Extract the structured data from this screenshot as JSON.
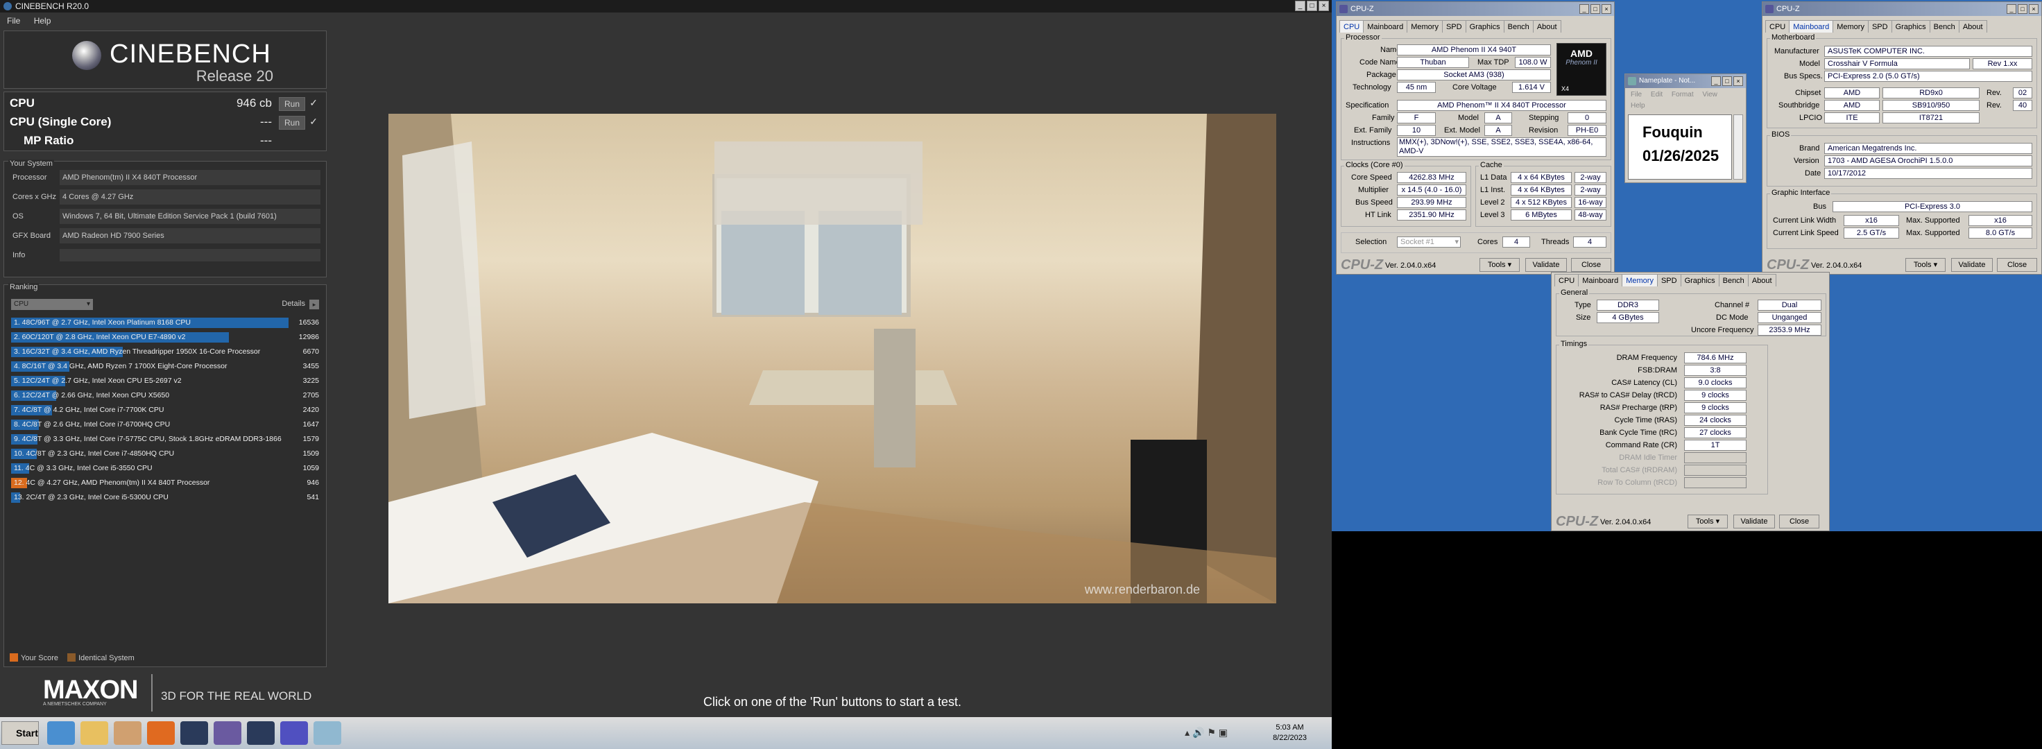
{
  "cinebench": {
    "title": "CINEBENCH R20.0",
    "menu": [
      "File",
      "Help"
    ],
    "logo": {
      "name": "CINEBENCH",
      "release": "Release 20"
    },
    "scores": [
      {
        "label": "CPU",
        "value": "946 cb",
        "run": "Run",
        "check": "✓"
      },
      {
        "label": "CPU (Single Core)",
        "value": "---",
        "run": "Run",
        "check": "✓"
      },
      {
        "label": "MP Ratio",
        "value": "---"
      }
    ],
    "system": {
      "header": "Your System",
      "rows": [
        {
          "label": "Processor",
          "value": "AMD Phenom(tm) II X4 840T Processor"
        },
        {
          "label": "Cores x GHz",
          "value": "4 Cores @ 4.27 GHz"
        },
        {
          "label": "OS",
          "value": "Windows 7, 64 Bit, Ultimate Edition Service Pack 1 (build 7601)"
        },
        {
          "label": "GFX Board",
          "value": "AMD Radeon HD 7900 Series"
        },
        {
          "label": "Info",
          "value": ""
        }
      ]
    },
    "ranking": {
      "header": "Ranking",
      "dropdown": "CPU",
      "details": "Details",
      "rows": [
        {
          "text": "1. 48C/96T @ 2.7 GHz, Intel Xeon Platinum 8168 CPU",
          "score": 16536,
          "me": false
        },
        {
          "text": "2. 60C/120T @ 2.8 GHz, Intel Xeon CPU E7-4890 v2",
          "score": 12986,
          "me": false
        },
        {
          "text": "3. 16C/32T @ 3.4 GHz, AMD Ryzen Threadripper 1950X 16-Core Processor",
          "score": 6670,
          "me": false
        },
        {
          "text": "4. 8C/16T @ 3.4 GHz, AMD Ryzen 7 1700X Eight-Core Processor",
          "score": 3455,
          "me": false
        },
        {
          "text": "5. 12C/24T @ 2.7 GHz, Intel Xeon CPU E5-2697 v2",
          "score": 3225,
          "me": false
        },
        {
          "text": "6. 12C/24T @ 2.66 GHz, Intel Xeon CPU X5650",
          "score": 2705,
          "me": false
        },
        {
          "text": "7. 4C/8T @ 4.2 GHz, Intel Core i7-7700K CPU",
          "score": 2420,
          "me": false
        },
        {
          "text": "8. 4C/8T @ 2.6 GHz, Intel Core i7-6700HQ CPU",
          "score": 1647,
          "me": false
        },
        {
          "text": "9. 4C/8T @ 3.3 GHz, Intel Core i7-5775C CPU, Stock 1.8GHz eDRAM DDR3-1866",
          "score": 1579,
          "me": false
        },
        {
          "text": "10. 4C/8T @ 2.3 GHz, Intel Core i7-4850HQ CPU",
          "score": 1509,
          "me": false
        },
        {
          "text": "11. 4C @ 3.3 GHz, Intel Core i5-3550 CPU",
          "score": 1059,
          "me": false
        },
        {
          "text": "12. 4C @ 4.27 GHz, AMD Phenom(tm) II X4 840T Processor",
          "score": 946,
          "me": true
        },
        {
          "text": "13. 2C/4T @ 2.3 GHz, Intel Core i5-5300U CPU",
          "score": 541,
          "me": false
        }
      ],
      "max": 16536,
      "legend": [
        "Your Score",
        "Identical System"
      ]
    },
    "maxon": {
      "name": "MAXON",
      "sub": "A NEMETSCHEK COMPANY",
      "tagline": "3D FOR THE REAL WORLD"
    },
    "render_watermark": "www.renderbaron.de",
    "hint": "Click on one of the 'Run' buttons to start a test.",
    "taskbar": {
      "start": "Start",
      "time": "5:03 AM",
      "date": "8/22/2023"
    }
  },
  "cpuz_cpu": {
    "title": "CPU-Z",
    "tabs": [
      "CPU",
      "Mainboard",
      "Memory",
      "SPD",
      "Graphics",
      "Bench",
      "About"
    ],
    "processor": {
      "header": "Processor",
      "name": "AMD Phenom II X4 940T",
      "code_name": "Thuban",
      "max_tdp": "108.0 W",
      "package": "Socket AM3 (938)",
      "technology": "45 nm",
      "core_voltage": "1.614 V",
      "specification": "AMD Phenom™ II X4 840T Processor",
      "family": "F",
      "model": "A",
      "stepping": "0",
      "ext_family": "10",
      "ext_model": "A",
      "revision": "PH-E0",
      "instructions": "MMX(+), 3DNow!(+), SSE, SSE2, SSE3, SSE4A, x86-64, AMD-V"
    },
    "labels": {
      "name": "Name",
      "code_name": "Code Name",
      "max_tdp": "Max TDP",
      "package": "Package",
      "technology": "Technology",
      "core_voltage": "Core Voltage",
      "specification": "Specification",
      "family": "Family",
      "model": "Model",
      "stepping": "Stepping",
      "ext_family": "Ext. Family",
      "ext_model": "Ext. Model",
      "revision": "Revision",
      "instructions": "Instructions"
    },
    "clocks": {
      "header": "Clocks (Core #0)",
      "core_speed": "4262.83 MHz",
      "multiplier": "x 14.5 (4.0 - 16.0)",
      "bus_speed": "293.99 MHz",
      "ht_link": "2351.90 MHz",
      "labels": [
        "Core Speed",
        "Multiplier",
        "Bus Speed",
        "HT Link"
      ]
    },
    "cache": {
      "header": "Cache",
      "rows": [
        {
          "label": "L1 Data",
          "size": "4 x 64 KBytes",
          "way": "2-way"
        },
        {
          "label": "L1 Inst.",
          "size": "4 x 64 KBytes",
          "way": "2-way"
        },
        {
          "label": "Level 2",
          "size": "4 x 512 KBytes",
          "way": "16-way"
        },
        {
          "label": "Level 3",
          "size": "6 MBytes",
          "way": "48-way"
        }
      ]
    },
    "selection": {
      "label": "Selection",
      "value": "Socket #1",
      "cores_label": "Cores",
      "cores": "4",
      "threads_label": "Threads",
      "threads": "4"
    },
    "badge": {
      "brand": "AMD",
      "line": "Phenom II",
      "sub": "X4"
    },
    "bottom": {
      "logo": "CPU-Z",
      "version": "Ver. 2.04.0.x64",
      "tools": "Tools",
      "validate": "Validate",
      "close": "Close"
    }
  },
  "cpuz_mb": {
    "title": "CPU-Z",
    "tabs": [
      "CPU",
      "Mainboard",
      "Memory",
      "SPD",
      "Graphics",
      "Bench",
      "About"
    ],
    "motherboard": {
      "header": "Motherboard",
      "manufacturer": "ASUSTeK COMPUTER INC.",
      "model": "Crosshair V Formula",
      "model_rev": "Rev 1.xx",
      "bus_specs": "PCI-Express 2.0 (5.0 GT/s)",
      "chipset": "AMD",
      "chipset_model": "RD9x0",
      "chipset_rev": "02",
      "southbridge": "AMD",
      "southbridge_model": "SB910/950",
      "southbridge_rev": "40",
      "lpcio": "ITE",
      "lpcio_model": "IT8721",
      "labels": {
        "manufacturer": "Manufacturer",
        "model": "Model",
        "bus_specs": "Bus Specs.",
        "chipset": "Chipset",
        "southbridge": "Southbridge",
        "lpcio": "LPCIO",
        "rev": "Rev."
      }
    },
    "bios": {
      "header": "BIOS",
      "brand": "American Megatrends Inc.",
      "version": "1703 - AMD AGESA OrochiPI 1.5.0.0",
      "date": "10/17/2012",
      "labels": {
        "brand": "Brand",
        "version": "Version",
        "date": "Date"
      }
    },
    "graphic": {
      "header": "Graphic Interface",
      "bus": "PCI-Express 3.0",
      "link_width": "x16",
      "max_width": "x16",
      "link_speed": "2.5 GT/s",
      "max_speed": "8.0 GT/s",
      "labels": {
        "bus": "Bus",
        "link_width": "Current Link Width",
        "max_width": "Max. Supported",
        "link_speed": "Current Link Speed",
        "max_speed": "Max. Supported"
      }
    },
    "bottom": {
      "logo": "CPU-Z",
      "version": "Ver. 2.04.0.x64",
      "tools": "Tools",
      "validate": "Validate",
      "close": "Close"
    }
  },
  "cpuz_mem": {
    "tabs": [
      "CPU",
      "Mainboard",
      "Memory",
      "SPD",
      "Graphics",
      "Bench",
      "About"
    ],
    "general": {
      "header": "General",
      "type": "DDR3",
      "size": "4 GBytes",
      "channel": "Dual",
      "dc_mode": "Unganged",
      "uncore": "2353.9 MHz",
      "labels": {
        "type": "Type",
        "size": "Size",
        "channel": "Channel #",
        "dc_mode": "DC Mode",
        "uncore": "Uncore Frequency"
      }
    },
    "timings": {
      "header": "Timings",
      "rows": [
        {
          "label": "DRAM Frequency",
          "value": "784.6 MHz"
        },
        {
          "label": "FSB:DRAM",
          "value": "3:8"
        },
        {
          "label": "CAS# Latency (CL)",
          "value": "9.0 clocks"
        },
        {
          "label": "RAS# to CAS# Delay (tRCD)",
          "value": "9 clocks"
        },
        {
          "label": "RAS# Precharge (tRP)",
          "value": "9 clocks"
        },
        {
          "label": "Cycle Time (tRAS)",
          "value": "24 clocks"
        },
        {
          "label": "Bank Cycle Time (tRC)",
          "value": "27 clocks"
        },
        {
          "label": "Command Rate (CR)",
          "value": "1T"
        },
        {
          "label": "DRAM Idle Timer",
          "value": ""
        },
        {
          "label": "Total CAS# (tRDRAM)",
          "value": ""
        },
        {
          "label": "Row To Column (tRCD)",
          "value": ""
        }
      ]
    },
    "bottom": {
      "logo": "CPU-Z",
      "version": "Ver. 2.04.0.x64",
      "tools": "Tools",
      "validate": "Validate",
      "close": "Close"
    }
  },
  "notepad": {
    "title": "Nameplate - Not...",
    "menu": [
      "File",
      "Edit",
      "Format",
      "View",
      "Help"
    ],
    "line1": "Fouquin",
    "line2": "01/26/2025"
  }
}
